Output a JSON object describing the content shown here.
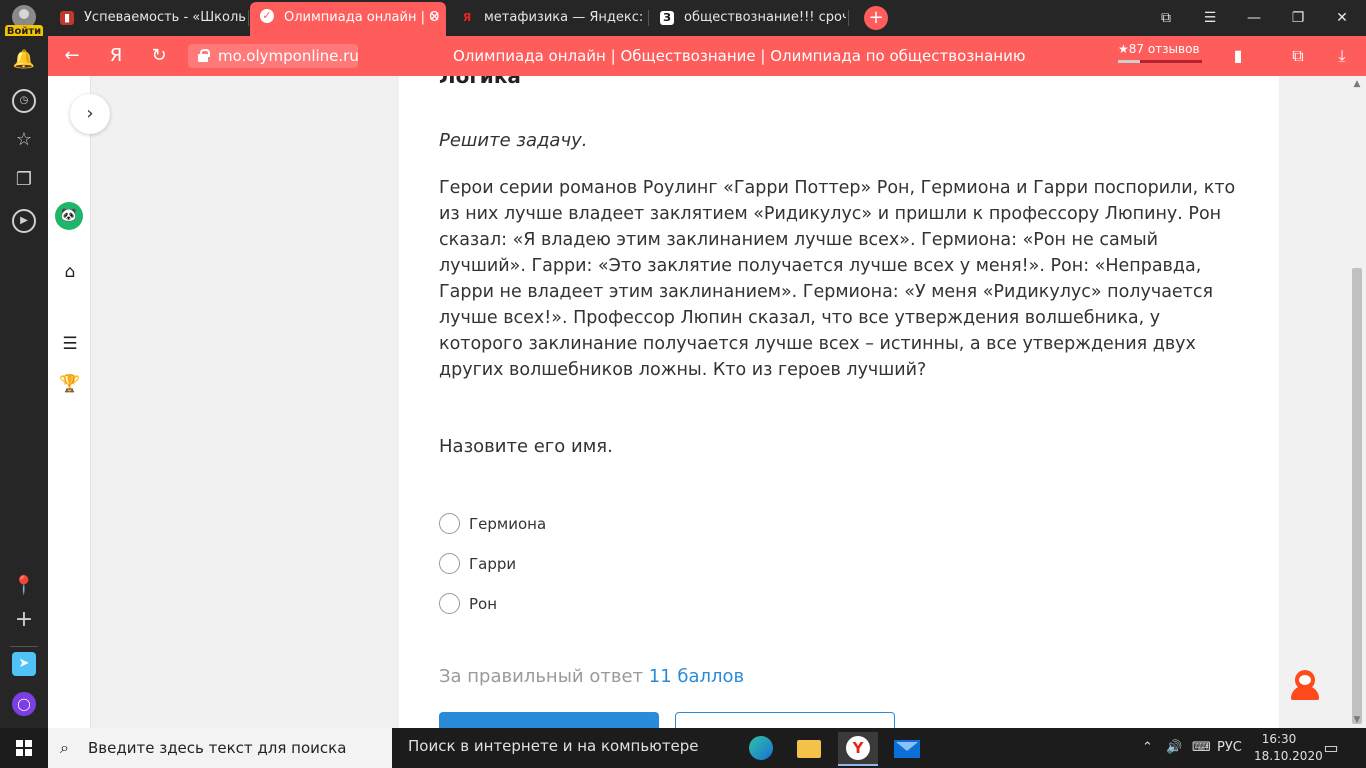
{
  "profile": {
    "login_label": "Войти"
  },
  "tabs": [
    {
      "title": "Успеваемость - «Школьн",
      "favicon": "book-icon"
    },
    {
      "title": "Олимпиада онлайн | О",
      "favicon": "olymp-icon",
      "active": true
    },
    {
      "title": "метафизика — Яндекс: на",
      "favicon": "yandex-icon"
    },
    {
      "title": "обществознание!!! срочно",
      "favicon": "znanija-icon"
    }
  ],
  "tab_favicon_letters": {
    "yandex": "Я",
    "znanija": "З"
  },
  "address": {
    "url": "mo.olymponline.ru",
    "page_title": "Олимпиада онлайн | Обществознание | Олимпиада по обществознанию",
    "reviews": "★87 отзывов",
    "reviews_rating_fraction": 0.26
  },
  "content": {
    "section_title": "Логика",
    "task_intro": "Решите задачу.",
    "task_text": "Герои серии романов Роулинг «Гарри Поттер» Рон, Гермиона и Гарри поспорили, кто из них лучше владеет заклятием «Ридикулус» и пришли к профессору Люпину. Рон сказал: «Я владею этим заклинанием лучше всех». Гермиона: «Рон не самый лучший». Гарри: «Это заклятие получается лучше всех у меня!». Рон: «Неправда, Гарри не владеет этим заклинанием». Гермиона: «У меня «Ридикулус» получается лучше всех!». Профессор Люпин сказал, что все утверждения волшебника, у которого заклинание получается лучше всех – истинны, а все утверждения двух других волшебников ложны. Кто из героев лучший?",
    "question": "Назовите его имя.",
    "options": [
      {
        "label": "Гермиона",
        "selected": false
      },
      {
        "label": "Гарри",
        "selected": false
      },
      {
        "label": "Рон",
        "selected": false
      }
    ],
    "points_prefix": "За правильный ответ",
    "points_value": "11 баллов"
  },
  "taskbar": {
    "search_placeholder": "Введите здесь текст для поиска",
    "web_search_label": "Поиск в интернете и на компьютере",
    "language": "РУС",
    "time": "16:30",
    "date": "18.10.2020"
  },
  "colors": {
    "accent": "#ff5c5c",
    "link": "#2a8bd8",
    "muted": "#9a9a9a"
  }
}
